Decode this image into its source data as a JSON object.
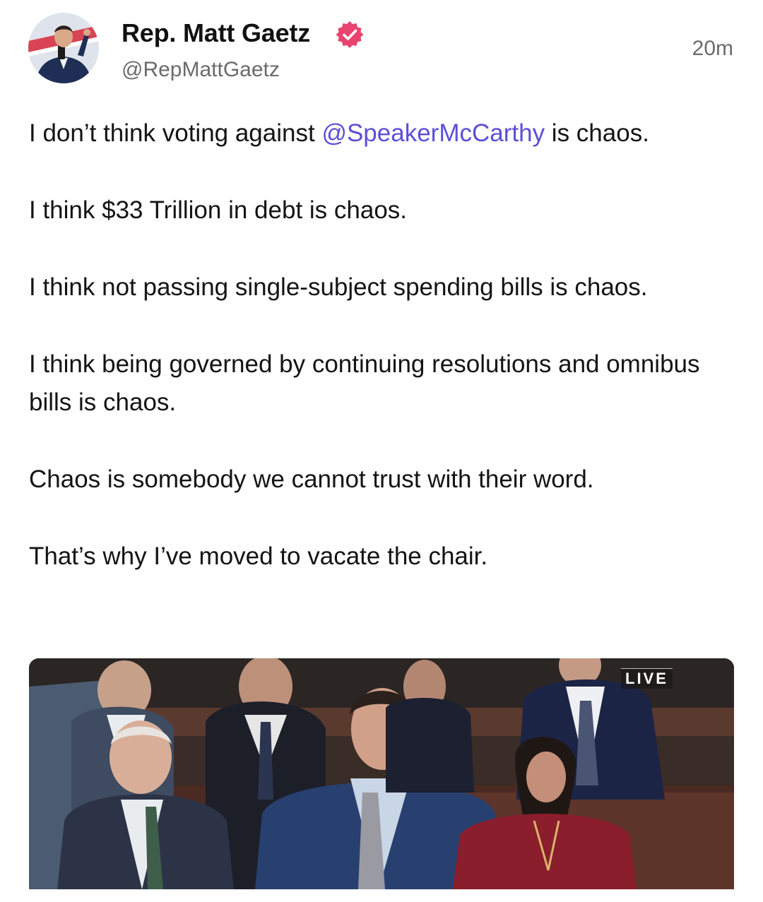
{
  "post": {
    "author_name": "Rep. Matt Gaetz",
    "handle": "@RepMattGaetz",
    "timestamp": "20m",
    "verified_icon": "verified-badge-icon",
    "paragraphs": [
      {
        "before": "I don’t think voting against ",
        "mention": "@SpeakerMcCarthy",
        "after": " is chaos."
      },
      {
        "text": "I think $33 Trillion in debt is chaos."
      },
      {
        "text": "I think not passing single-subject spending bills is chaos."
      },
      {
        "text": "I think being governed by continuing resolutions and omnibus bills is chaos."
      },
      {
        "text": "Chaos is somebody we cannot trust with their word."
      },
      {
        "text": "That’s why I’ve moved to vacate the chair."
      }
    ],
    "media": {
      "badge": "LIVE"
    }
  },
  "colors": {
    "mention": "#5b4fd6",
    "verified_badge": "#e8446f",
    "secondary_text": "#6b6b6b"
  }
}
